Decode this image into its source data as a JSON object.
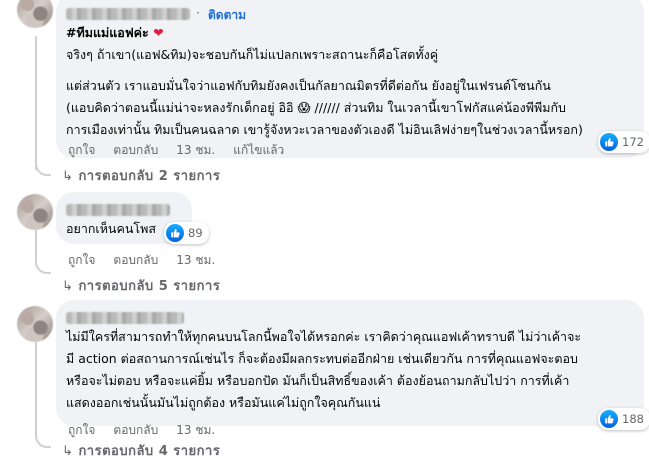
{
  "comments": [
    {
      "follow_label": "ติดตาม",
      "lines": [
        "#ทีมแม่แอฟค่ะ",
        "จริงๆ ถ้าเขา(แอฟ&ทิม)จะชอบกันก็ไม่แปลกเพราะสถานะก็คือโสดทั้งคู่",
        "แต่ส่วนตัว เราแอบมั่นใจว่าแอฟกับทิมยังคงเป็นกัลยาณมิตรที่ดีต่อกัน ยังอยู่ในเฟรนด์โซนกัน",
        "(แอบคิดว่าตอนนี้แม่น่าจะหลงรักเด็กอยู่ อิอิ 😱 ////// ส่วนทิม ในเวลานี้เขาโฟกัสแค่น้องพีพีมกับ",
        "การเมืองเท่านั้น ทิมเป็นคนฉลาด เขารู้จังหวะเวลาของตัวเองดี ไม่อินเลิฟง่ายๆในช่วงเวลานี้หรอก)"
      ],
      "actions": {
        "like": "ถูกใจ",
        "reply": "ตอบกลับ",
        "time": "13 ชม.",
        "edited": "แก้ไขแล้ว"
      },
      "reaction_count": "172",
      "replies_label": "การตอบกลับ 2 รายการ"
    },
    {
      "lines": [
        "อยากเห็นคนโพส"
      ],
      "actions": {
        "like": "ถูกใจ",
        "reply": "ตอบกลับ",
        "time": "13 ชม."
      },
      "reaction_count": "89",
      "replies_label": "การตอบกลับ 5 รายการ"
    },
    {
      "lines": [
        "ไม่มีใครที่สามารถทำให้ทุกคนบนโลกนี้พอใจได้หรอกค่ะ เราคิดว่าคุณแอฟเค้าทราบดี ไม่ว่าเค้าจะ",
        "มี action ต่อสถานการณ์เช่นไร ก็จะต้องมีผลกระทบต่ออีกฝ่าย เช่นเดียวกัน การที่คุณแอฟจะตอบ",
        "หรือจะไม่ตอบ หรือจะแค่ยิ้ม หรือบอกปัด มันก็เป็นสิทธิ์ของเค้า ต้องย้อนถามกลับไปว่า การที่เค้า",
        "แสดงออกเช่นนั้นมันไม่ถูกต้อง หรือมันแค่ไม่ถูกใจคุณกันแน่"
      ],
      "actions": {
        "like": "ถูกใจ",
        "reply": "ตอบกลับ",
        "time": "13 ชม."
      },
      "reaction_count": "188",
      "replies_label": "การตอบกลับ 4 รายการ"
    }
  ],
  "icons": {
    "reaction": "like-icon",
    "reply_arrow": "reply-arrow-icon",
    "heart": "heart-icon"
  },
  "colors": {
    "bubble": "#f0f2f5",
    "follow": "#216fdb",
    "meta": "#65676b",
    "like": "#0866ff",
    "heart": "#e41e3f"
  }
}
